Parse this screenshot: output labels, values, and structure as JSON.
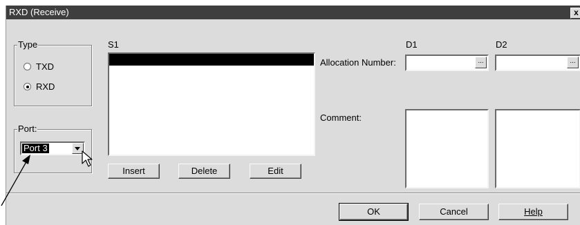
{
  "dialog": {
    "title": "RXD (Receive)",
    "close_glyph": "x"
  },
  "type_group": {
    "legend": "Type",
    "options": [
      {
        "label": "TXD",
        "selected": false
      },
      {
        "label": "RXD",
        "selected": true
      }
    ]
  },
  "port_group": {
    "legend": "Port:",
    "selected": "Port 3"
  },
  "s1": {
    "label": "S1",
    "buttons": {
      "insert": "Insert",
      "delete": "Delete",
      "edit": "Edit"
    }
  },
  "allocation": {
    "label": "Allocation Number:",
    "d1_label": "D1",
    "d2_label": "D2",
    "browse_glyph": "..."
  },
  "comment": {
    "label": "Comment:"
  },
  "footer": {
    "ok": "OK",
    "cancel": "Cancel",
    "help": "Help"
  },
  "icons": {
    "dropdown": "chevron-down-icon",
    "cursor": "mouse-pointer-icon",
    "callout": "callout-arrow"
  }
}
